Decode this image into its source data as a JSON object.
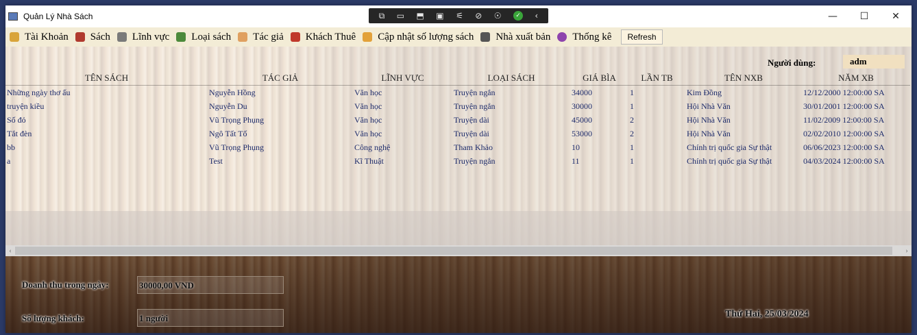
{
  "window": {
    "title": "Quản Lý Nhà Sách"
  },
  "menu": {
    "items": [
      {
        "label": "Tài Khoản",
        "icon": "user-icon",
        "color": "#d9a43a"
      },
      {
        "label": "Sách",
        "icon": "book-icon",
        "color": "#b03a2e"
      },
      {
        "label": "Lĩnh vực",
        "icon": "clipboard-icon",
        "color": "#7a7a7a"
      },
      {
        "label": "Loại sách",
        "icon": "books-stack-icon",
        "color": "#4c8a3b"
      },
      {
        "label": "Tác giả",
        "icon": "author-icon",
        "color": "#e0a060"
      },
      {
        "label": "Khách Thuê",
        "icon": "customer-icon",
        "color": "#c0392b"
      },
      {
        "label": "Cập nhật số lượng sách",
        "icon": "update-icon",
        "color": "#e2a13a"
      },
      {
        "label": "Nhà xuất bản",
        "icon": "publisher-icon",
        "color": "#555555"
      },
      {
        "label": "Thống kê",
        "icon": "stats-icon",
        "color": "#8e44ad"
      }
    ],
    "refresh_label": "Refresh"
  },
  "user": {
    "label": "Người dùng:",
    "value": "adm"
  },
  "table": {
    "headers": [
      "TÊN SÁCH",
      "TÁC GIẢ",
      "LĨNH VỰC",
      "LOẠI SÁCH",
      "GIÁ BÌA",
      "LẦN TB",
      "TÊN NXB",
      "NĂM XB"
    ],
    "rows": [
      [
        "Những ngày thơ ấu",
        "Nguyễn Hồng",
        "Văn học",
        "Truyện ngắn",
        "34000",
        "1",
        "Kim Đồng",
        "12/12/2000 12:00:00 SA"
      ],
      [
        "truyện kiều",
        "Nguyễn Du",
        "Văn học",
        "Truyện ngắn",
        "30000",
        "1",
        "Hội Nhà Văn",
        "30/01/2001 12:00:00 SA"
      ],
      [
        "Số đỏ",
        "Vũ Trọng Phụng",
        "Văn học",
        "Truyện dài",
        "45000",
        "2",
        "Hội Nhà Văn",
        "11/02/2009 12:00:00 SA"
      ],
      [
        "Tắt đèn",
        "Ngô Tất Tố",
        "Văn học",
        "Truyện dài",
        "53000",
        "2",
        "Hội Nhà Văn",
        "02/02/2010 12:00:00 SA"
      ],
      [
        "bb",
        "Vũ Trọng Phụng",
        "Công nghệ",
        "Tham Khảo",
        "10",
        "1",
        "Chính trị quốc gia Sự thật",
        "06/06/2023 12:00:00 SA"
      ],
      [
        "a",
        "Test",
        "Kĩ Thuật",
        "Truyện ngắn",
        "11",
        "1",
        "Chính trị quốc gia Sự thật",
        "04/03/2024 12:00:00 SA"
      ]
    ]
  },
  "stats": {
    "revenue_label": "Doanh thu trong ngày:",
    "revenue_value": "30000,00 VND",
    "count_label": "Số lượng khách:",
    "count_value": "1 người"
  },
  "date": "Thứ Hai, 25/03/2024"
}
